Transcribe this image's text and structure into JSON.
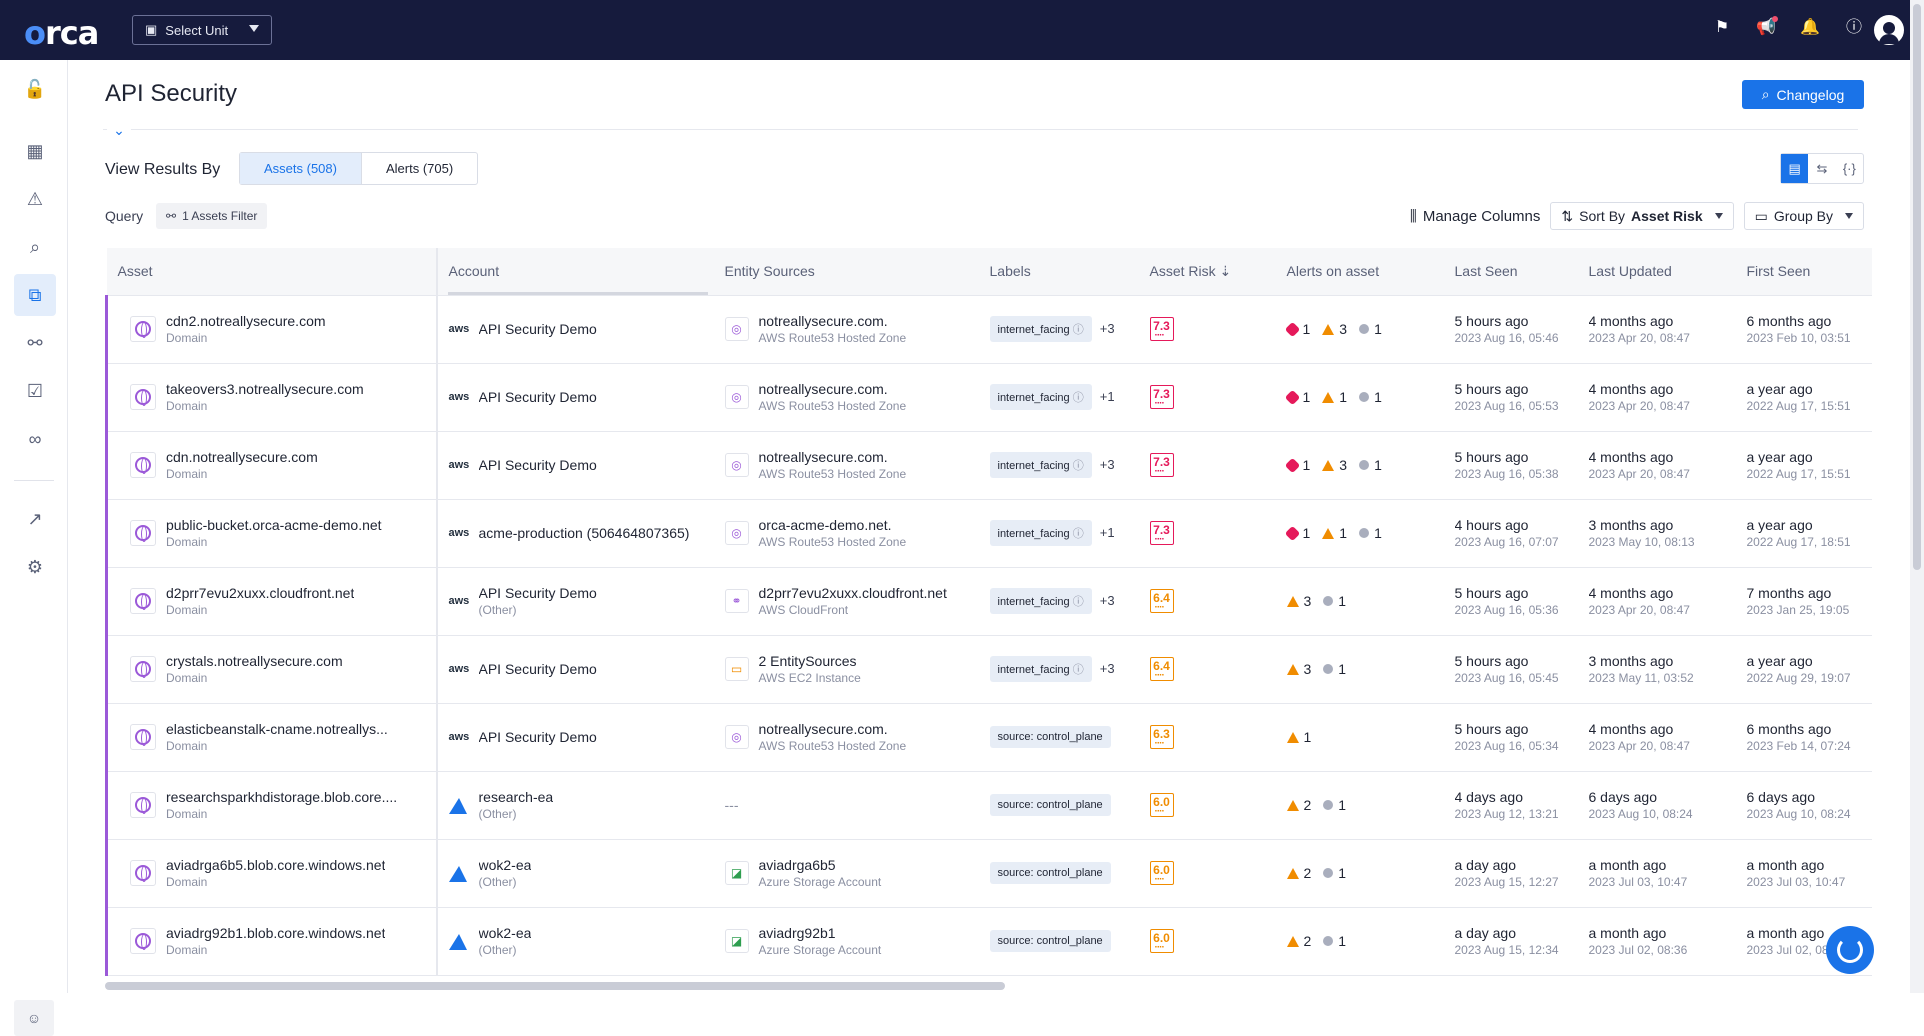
{
  "app": {
    "logo": "orca",
    "unit_select": "Select Unit"
  },
  "top_icons": [
    "flag-icon",
    "megaphone-icon",
    "bell-icon",
    "help-icon"
  ],
  "sidebar": {
    "items": [
      "lock-icon",
      "dashboard-icon",
      "alert-triangle-icon",
      "search-icon",
      "api-icon",
      "graph-icon",
      "clipboard-check-icon",
      "glasses-icon",
      "share-icon",
      "gear-icon"
    ],
    "active": "api-icon"
  },
  "page": {
    "title": "API Security",
    "changelog_label": "Changelog"
  },
  "view_by": {
    "label": "View Results By",
    "assets_tab": "Assets (508)",
    "alerts_tab": "Alerts (705)"
  },
  "query": {
    "label": "Query",
    "filter_chip": "1 Assets Filter"
  },
  "toolbar": {
    "manage_columns": "Manage Columns",
    "sort_by_label": "Sort By",
    "sort_by_value": "Asset Risk",
    "group_by": "Group By"
  },
  "columns": [
    "Asset",
    "Account",
    "Entity Sources",
    "Labels",
    "Asset Risk",
    "Alerts on asset",
    "Last Seen",
    "Last Updated",
    "First Seen"
  ],
  "rows": [
    {
      "asset": "cdn2.notreallysecure.com",
      "asset_type": "Domain",
      "account": "API Security Demo",
      "account_sub": "",
      "provider": "aws",
      "source": "notreallysecure.com.",
      "source_type": "AWS Route53 Hosted Zone",
      "source_icon": "globe",
      "label": "internet_facing",
      "label_more": "+3",
      "risk": "7.3",
      "risk_level": "high",
      "alerts": [
        {
          "sev": "crit",
          "n": "1"
        },
        {
          "sev": "high",
          "n": "3"
        },
        {
          "sev": "low",
          "n": "1"
        }
      ],
      "last_seen": "5 hours ago",
      "last_seen_date": "2023 Aug 16, 05:46",
      "last_updated": "4 months ago",
      "last_updated_date": "2023 Apr 20, 08:47",
      "first_seen": "6 months ago",
      "first_seen_date": "2023 Feb 10, 03:51"
    },
    {
      "asset": "takeovers3.notreallysecure.com",
      "asset_type": "Domain",
      "account": "API Security Demo",
      "account_sub": "",
      "provider": "aws",
      "source": "notreallysecure.com.",
      "source_type": "AWS Route53 Hosted Zone",
      "source_icon": "globe",
      "label": "internet_facing",
      "label_more": "+1",
      "risk": "7.3",
      "risk_level": "high",
      "alerts": [
        {
          "sev": "crit",
          "n": "1"
        },
        {
          "sev": "high",
          "n": "1"
        },
        {
          "sev": "low",
          "n": "1"
        }
      ],
      "last_seen": "5 hours ago",
      "last_seen_date": "2023 Aug 16, 05:53",
      "last_updated": "4 months ago",
      "last_updated_date": "2023 Apr 20, 08:47",
      "first_seen": "a year ago",
      "first_seen_date": "2022 Aug 17, 15:51"
    },
    {
      "asset": "cdn.notreallysecure.com",
      "asset_type": "Domain",
      "account": "API Security Demo",
      "account_sub": "",
      "provider": "aws",
      "source": "notreallysecure.com.",
      "source_type": "AWS Route53 Hosted Zone",
      "source_icon": "globe",
      "label": "internet_facing",
      "label_more": "+3",
      "risk": "7.3",
      "risk_level": "high",
      "alerts": [
        {
          "sev": "crit",
          "n": "1"
        },
        {
          "sev": "high",
          "n": "3"
        },
        {
          "sev": "low",
          "n": "1"
        }
      ],
      "last_seen": "5 hours ago",
      "last_seen_date": "2023 Aug 16, 05:38",
      "last_updated": "4 months ago",
      "last_updated_date": "2023 Apr 20, 08:47",
      "first_seen": "a year ago",
      "first_seen_date": "2022 Aug 17, 15:51"
    },
    {
      "asset": "public-bucket.orca-acme-demo.net",
      "asset_type": "Domain",
      "account": "acme-production (506464807365)",
      "account_sub": "",
      "provider": "aws",
      "source": "orca-acme-demo.net.",
      "source_type": "AWS Route53 Hosted Zone",
      "source_icon": "globe",
      "label": "internet_facing",
      "label_more": "+1",
      "risk": "7.3",
      "risk_level": "high",
      "alerts": [
        {
          "sev": "crit",
          "n": "1"
        },
        {
          "sev": "high",
          "n": "1"
        },
        {
          "sev": "low",
          "n": "1"
        }
      ],
      "last_seen": "4 hours ago",
      "last_seen_date": "2023 Aug 16, 07:07",
      "last_updated": "3 months ago",
      "last_updated_date": "2023 May 10, 08:13",
      "first_seen": "a year ago",
      "first_seen_date": "2022 Aug 17, 18:51"
    },
    {
      "asset": "d2prr7evu2xuxx.cloudfront.net",
      "asset_type": "Domain",
      "account": "API Security Demo",
      "account_sub": "(Other)",
      "provider": "aws",
      "source": "d2prr7evu2xuxx.cloudfront.net",
      "source_type": "AWS CloudFront",
      "source_icon": "cloudfront",
      "label": "internet_facing",
      "label_more": "+3",
      "risk": "6.4",
      "risk_level": "med",
      "alerts": [
        {
          "sev": "high",
          "n": "3"
        },
        {
          "sev": "low",
          "n": "1"
        }
      ],
      "last_seen": "5 hours ago",
      "last_seen_date": "2023 Aug 16, 05:36",
      "last_updated": "4 months ago",
      "last_updated_date": "2023 Apr 20, 08:47",
      "first_seen": "7 months ago",
      "first_seen_date": "2023 Jan 25, 19:05"
    },
    {
      "asset": "crystals.notreallysecure.com",
      "asset_type": "Domain",
      "account": "API Security Demo",
      "account_sub": "",
      "provider": "aws",
      "source": "2 EntitySources",
      "source_type": "AWS EC2 Instance",
      "source_icon": "ec2",
      "label": "internet_facing",
      "label_more": "+3",
      "risk": "6.4",
      "risk_level": "med",
      "alerts": [
        {
          "sev": "high",
          "n": "3"
        },
        {
          "sev": "low",
          "n": "1"
        }
      ],
      "last_seen": "5 hours ago",
      "last_seen_date": "2023 Aug 16, 05:45",
      "last_updated": "3 months ago",
      "last_updated_date": "2023 May 11, 03:52",
      "first_seen": "a year ago",
      "first_seen_date": "2022 Aug 29, 19:07"
    },
    {
      "asset": "elasticbeanstalk-cname.notreallys...",
      "asset_type": "Domain",
      "account": "API Security Demo",
      "account_sub": "",
      "provider": "aws",
      "source": "notreallysecure.com.",
      "source_type": "AWS Route53 Hosted Zone",
      "source_icon": "globe",
      "label": "source: control_plane",
      "label_more": "",
      "risk": "6.3",
      "risk_level": "med",
      "alerts": [
        {
          "sev": "high",
          "n": "1"
        }
      ],
      "last_seen": "5 hours ago",
      "last_seen_date": "2023 Aug 16, 05:34",
      "last_updated": "4 months ago",
      "last_updated_date": "2023 Apr 20, 08:47",
      "first_seen": "6 months ago",
      "first_seen_date": "2023 Feb 14, 07:24"
    },
    {
      "asset": "researchsparkhdistorage.blob.core....",
      "asset_type": "Domain",
      "account": "research-ea",
      "account_sub": "(Other)",
      "provider": "azure",
      "source": "---",
      "source_type": "",
      "source_icon": "none",
      "label": "source: control_plane",
      "label_more": "",
      "risk": "6.0",
      "risk_level": "med",
      "alerts": [
        {
          "sev": "high",
          "n": "2"
        },
        {
          "sev": "low",
          "n": "1"
        }
      ],
      "last_seen": "4 days ago",
      "last_seen_date": "2023 Aug 12, 13:21",
      "last_updated": "6 days ago",
      "last_updated_date": "2023 Aug 10, 08:24",
      "first_seen": "6 days ago",
      "first_seen_date": "2023 Aug 10, 08:24"
    },
    {
      "asset": "aviadrga6b5.blob.core.windows.net",
      "asset_type": "Domain",
      "account": "wok2-ea",
      "account_sub": "(Other)",
      "provider": "azure",
      "source": "aviadrga6b5",
      "source_type": "Azure Storage Account",
      "source_icon": "storage",
      "label": "source: control_plane",
      "label_more": "",
      "risk": "6.0",
      "risk_level": "med",
      "alerts": [
        {
          "sev": "high",
          "n": "2"
        },
        {
          "sev": "low",
          "n": "1"
        }
      ],
      "last_seen": "a day ago",
      "last_seen_date": "2023 Aug 15, 12:27",
      "last_updated": "a month ago",
      "last_updated_date": "2023 Jul 03, 10:47",
      "first_seen": "a month ago",
      "first_seen_date": "2023 Jul 03, 10:47"
    },
    {
      "asset": "aviadrg92b1.blob.core.windows.net",
      "asset_type": "Domain",
      "account": "wok2-ea",
      "account_sub": "(Other)",
      "provider": "azure",
      "source": "aviadrg92b1",
      "source_type": "Azure Storage Account",
      "source_icon": "storage",
      "label": "source: control_plane",
      "label_more": "",
      "risk": "6.0",
      "risk_level": "med",
      "alerts": [
        {
          "sev": "high",
          "n": "2"
        },
        {
          "sev": "low",
          "n": "1"
        }
      ],
      "last_seen": "a day ago",
      "last_seen_date": "2023 Aug 15, 12:34",
      "last_updated": "a month ago",
      "last_updated_date": "2023 Jul 02, 08:36",
      "first_seen": "a month ago",
      "first_seen_date": "2023 Jul 02, 08:36"
    }
  ]
}
